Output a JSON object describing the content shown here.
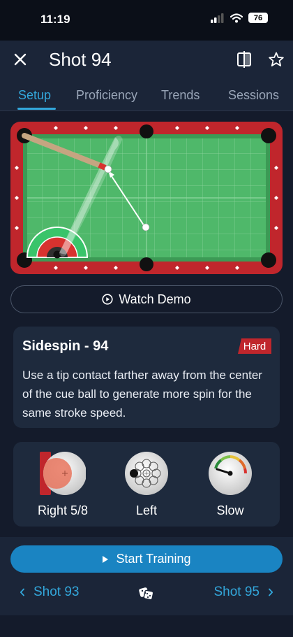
{
  "status": {
    "time": "11:19",
    "battery": "76"
  },
  "header": {
    "title": "Shot 94",
    "tabs": [
      {
        "label": "Setup"
      },
      {
        "label": "Proficiency"
      },
      {
        "label": "Trends"
      },
      {
        "label": "Sessions"
      }
    ]
  },
  "watch_demo": {
    "label": "Watch Demo"
  },
  "drill": {
    "title": "Sidespin - 94",
    "difficulty": "Hard",
    "description": "Use a tip contact farther away from the center of the cue ball to generate more spin for the same stroke speed."
  },
  "settings": {
    "tip": {
      "label": "Right 5/8"
    },
    "english": {
      "label": "Left"
    },
    "speed": {
      "label": "Slow"
    }
  },
  "footer": {
    "start_label": "Start Training",
    "prev_label": "Shot 93",
    "next_label": "Shot 95"
  },
  "colors": {
    "accent": "#33a7db",
    "button": "#1a84c2",
    "rail": "#c0262c",
    "felt": "#4fb86a",
    "badge": "#c0262c"
  },
  "icons": [
    "close-icon",
    "compare-icon",
    "star-icon",
    "play-circle-icon",
    "play-icon",
    "chevron-left-icon",
    "chevron-right-icon",
    "dice-icon"
  ]
}
